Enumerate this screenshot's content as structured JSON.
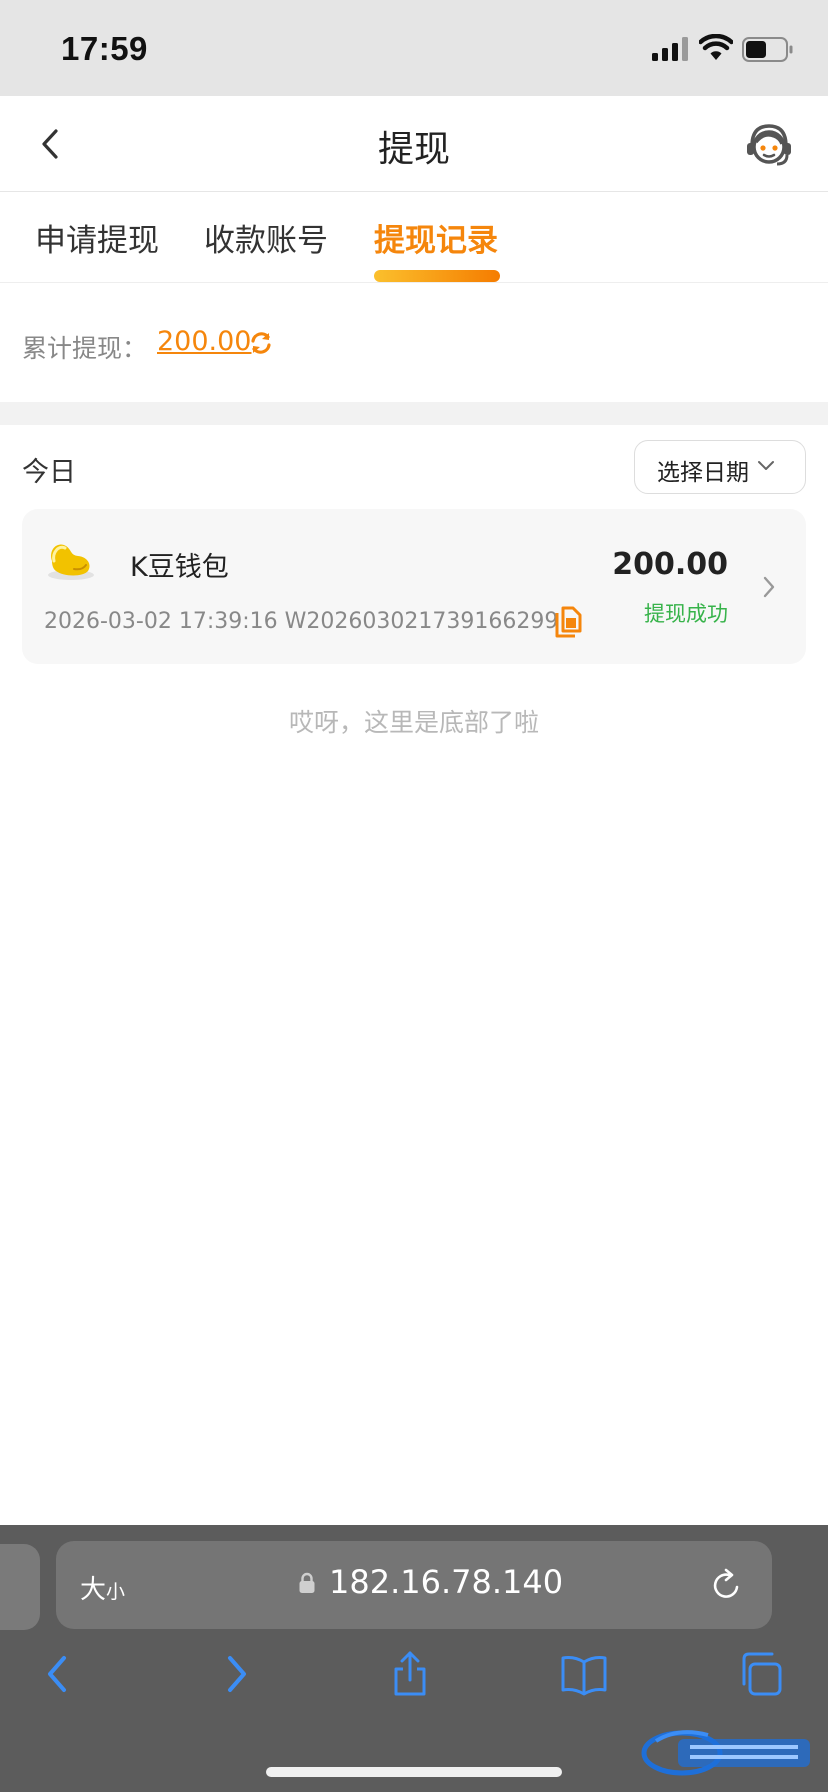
{
  "status_bar": {
    "time": "17:59"
  },
  "header": {
    "title": "提现"
  },
  "tabs": [
    {
      "label": "申请提现",
      "active": false
    },
    {
      "label": "收款账号",
      "active": false
    },
    {
      "label": "提现记录",
      "active": true
    }
  ],
  "summary": {
    "label": "累计提现：",
    "value": "200.00"
  },
  "filter": {
    "day_label": "今日",
    "date_picker_label": "选择日期"
  },
  "records": [
    {
      "wallet": "K豆钱包",
      "time": "2026-03-02 17:39:16",
      "order_no": "W202603021739166299",
      "amount": "200.00",
      "status": "提现成功"
    }
  ],
  "end_message": "哎呀，这里是底部了啦",
  "browser": {
    "text_size_large": "大",
    "text_size_small": "小",
    "url": "182.16.78.140"
  },
  "colors": {
    "accent": "#f5860c",
    "success": "#37b34a",
    "browser_toolbar": "#5c5c5c",
    "toolbar_icon": "#3b8df5"
  },
  "icons": {
    "back": "chevron-left-icon",
    "service": "customer-service-icon",
    "refresh": "refresh-icon",
    "date_dropdown": "chevron-down-icon",
    "wallet": "bean-icon",
    "copy": "copy-icon",
    "detail": "chevron-right-icon",
    "lock": "lock-icon",
    "reload": "reload-icon",
    "toolbar": [
      "back-arrow-icon",
      "forward-arrow-icon",
      "share-icon",
      "bookmarks-icon",
      "tabs-icon"
    ]
  }
}
